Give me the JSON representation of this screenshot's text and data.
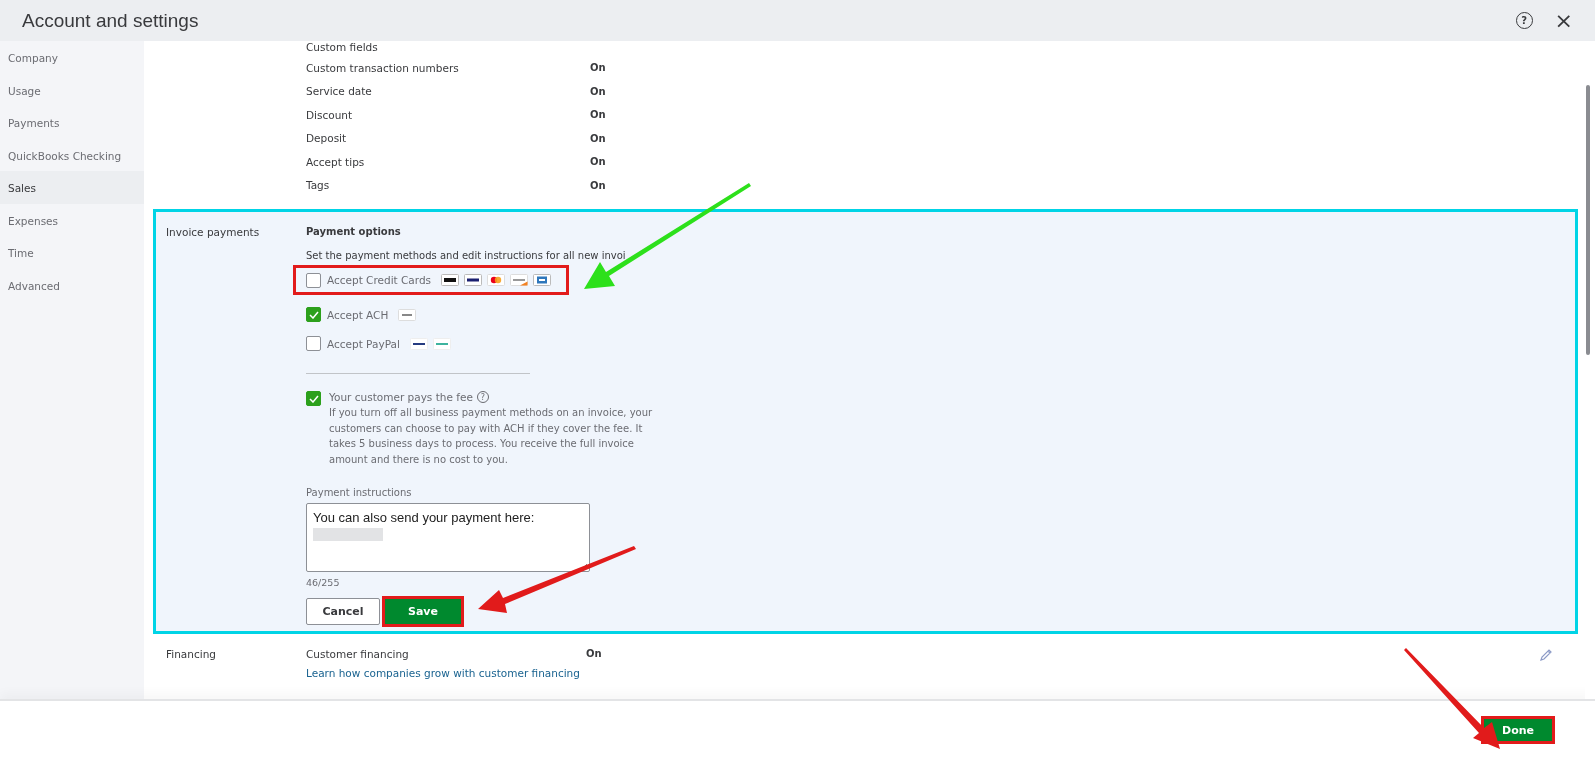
{
  "window": {
    "title": "Account and settings",
    "help_glyph": "?",
    "close_glyph": "×"
  },
  "sidebar": {
    "items": [
      {
        "label": "Company",
        "selected": false
      },
      {
        "label": "Usage",
        "selected": false
      },
      {
        "label": "Payments",
        "selected": false
      },
      {
        "label": "QuickBooks Checking",
        "selected": false
      },
      {
        "label": "Sales",
        "selected": true
      },
      {
        "label": "Expenses",
        "selected": false
      },
      {
        "label": "Time",
        "selected": false
      },
      {
        "label": "Advanced",
        "selected": false
      }
    ]
  },
  "settings_rows": [
    {
      "name": "Custom fields"
    },
    {
      "name": "Custom transaction numbers",
      "value": "On"
    },
    {
      "name": "Service date",
      "value": "On"
    },
    {
      "name": "Discount",
      "value": "On"
    },
    {
      "name": "Deposit",
      "value": "On"
    },
    {
      "name": "Accept tips",
      "value": "On"
    },
    {
      "name": "Tags",
      "value": "On"
    }
  ],
  "invoice_payments": {
    "label": "Invoice payments",
    "heading": "Payment options",
    "description": "Set the payment methods and edit instructions for all new invoi",
    "methods": [
      {
        "label": "Accept Credit Cards",
        "checked": false,
        "highlighted": true
      },
      {
        "label": "Accept ACH",
        "checked": true,
        "highlighted": false
      },
      {
        "label": "Accept PayPal",
        "checked": false,
        "highlighted": false
      }
    ],
    "fee": {
      "label": "Your customer pays the fee",
      "help_glyph": "?",
      "checked": true,
      "note": "If you turn off all business payment methods on an invoice, your customers can choose to pay with ACH if they cover the fee. It takes 5 business days to process. You receive the full invoice amount and there is no cost to you."
    },
    "instructions": {
      "label": "Payment instructions",
      "value": "You can also send your payment here:",
      "counter": "46/255"
    },
    "cancel": "Cancel",
    "save": "Save"
  },
  "financing": {
    "label": "Financing",
    "name": "Customer financing",
    "value": "On",
    "link": "Learn how companies grow with customer financing"
  },
  "footer": {
    "done": "Done"
  }
}
